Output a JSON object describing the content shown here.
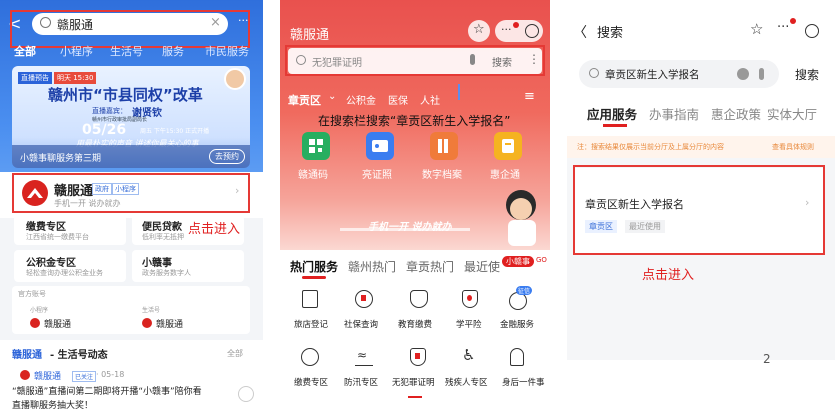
{
  "p1": {
    "search_value": "赣服通",
    "close_glyph": "×",
    "more_glyph": "···",
    "tabs": [
      "全部",
      "小程序",
      "生活号",
      "服务",
      "市民服务"
    ],
    "banner": {
      "live_badge": "直播预告",
      "live_time": "明天 15:30",
      "headline": "赣州市“市县同权”改革",
      "guest_label": "直播嘉宾：",
      "guest_name": "谢贤钦",
      "guest_title": "赣州市行政审批局副局长",
      "date": "05/26",
      "time_line": "周五 下午15:30 正式开播",
      "slogan": "用最朴实的声音 讲述你最关心的事",
      "program": "小赣事聊服务第三期",
      "cta": "去预约"
    },
    "app": {
      "name": "赣服通",
      "tag1": "政府",
      "tag2": "小程序",
      "subtitle": "手机一开 说办就办"
    },
    "annotation": "点击进入",
    "services": [
      {
        "title": "缴费专区",
        "desc": "江西省统一缴费平台"
      },
      {
        "title": "便民贷款",
        "desc": "低利率无抵押"
      },
      {
        "title": "公积金专区",
        "desc": "轻松查询办理公积金业务"
      },
      {
        "title": "小赣事",
        "desc": "政务服务数字人"
      }
    ],
    "official_label": "官方账号",
    "accounts": [
      {
        "type": "小程序",
        "name": "赣服通"
      },
      {
        "type": "生活号",
        "name": "赣服通"
      }
    ],
    "feed": {
      "title_brand": "赣服通",
      "title_rest": " - 生活号动态",
      "more": "全部",
      "post_name": "赣服通",
      "post_follow": "已关注",
      "post_date": "· 05-18",
      "post_text1": "“赣服通”直播间第二期即将开播“小赣事”陪你看",
      "post_text2": "直播聊服务抽大奖！"
    }
  },
  "p2": {
    "title": "赣服通",
    "search_placeholder": "无犯罪证明",
    "search_button": "搜索",
    "region": "章贡区",
    "nav": [
      "公积金",
      "医保",
      "人社"
    ],
    "hint": "在搜索栏搜索“章贡区新生入学报名”",
    "quick": [
      "赣通码",
      "亮证照",
      "数字档案",
      "惠企通"
    ],
    "slogan": "手机一开 说办就办",
    "mascot_label": "小赣事",
    "mascot_go": "GO",
    "tabs": [
      "热门服务",
      "赣州热门",
      "章贡热门",
      "最近使"
    ],
    "grid_row1": [
      "旅店登记",
      "社保查询",
      "教育缴费",
      "学平险",
      "金融服务"
    ],
    "grid_row2": [
      "缴费专区",
      "防汛专区",
      "无犯罪证明",
      "残疾人专区",
      "身后一件事"
    ],
    "badge": "征信"
  },
  "p3": {
    "back_glyph": "〈",
    "title": "搜索",
    "search_value": "章贡区新生入学报名",
    "search_button": "搜索",
    "tabs": [
      "应用服务",
      "办事指南",
      "惠企政策",
      "实体大厅"
    ],
    "notice": "注：搜索结果仅展示当前分厅及上属分厅的内容",
    "notice_link": "查看具体规则",
    "result_title": "章贡区新生入学报名",
    "result_tag": "章贡区",
    "result_recent": "最近使用",
    "annotation": "点击进入",
    "page_number": "2"
  },
  "colors": {
    "brand_red": "#e02020",
    "annot_red": "#e53935",
    "blue_brand": "#1c3fa8"
  }
}
